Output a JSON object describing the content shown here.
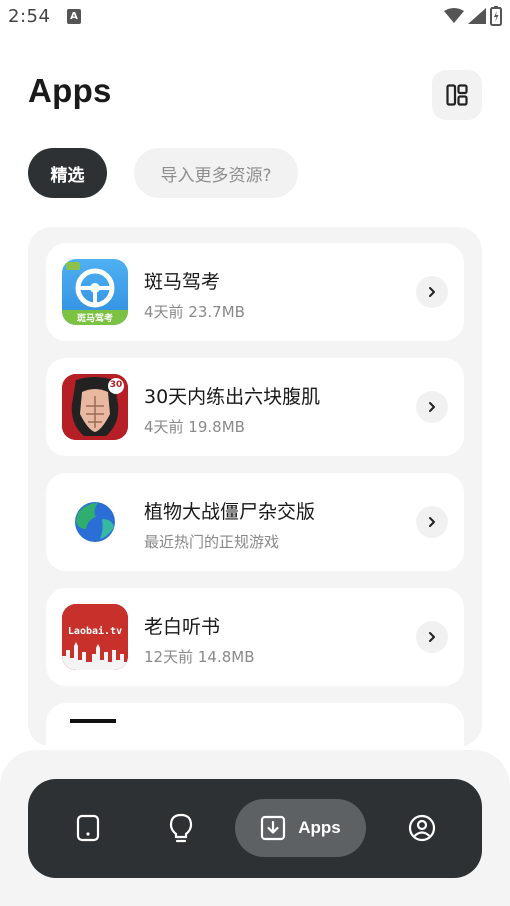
{
  "status_bar": {
    "time": "2:54",
    "notification_icon": "A"
  },
  "header": {
    "title": "Apps",
    "layout_icon": "layout-grid-icon"
  },
  "filters": {
    "selected_label": "精选",
    "import_label": "导入更多资源?"
  },
  "apps": [
    {
      "name": "斑马驾考",
      "meta": "4天前  23.7MB",
      "icon": "steering-wheel-icon",
      "badge": "斑马驾考"
    },
    {
      "name": "30天内练出六块腹肌",
      "meta": "4天前  19.8MB",
      "icon": "abs-fitness-icon",
      "badge": "30"
    },
    {
      "name": "植物大战僵尸杂交版",
      "meta": "最近热门的正规游戏",
      "icon": "globe-icon"
    },
    {
      "name": "老白听书",
      "meta": "12天前  14.8MB",
      "icon": "laobai-icon",
      "badge": "Laobai.tv"
    }
  ],
  "nav": {
    "active_label": "Apps",
    "items": [
      "phone-icon",
      "lightbulb-icon",
      "download-icon",
      "profile-icon"
    ]
  },
  "colors": {
    "dark": "#2e3133",
    "panel": "#f4f4f4",
    "active_pill": "#5d6164"
  }
}
